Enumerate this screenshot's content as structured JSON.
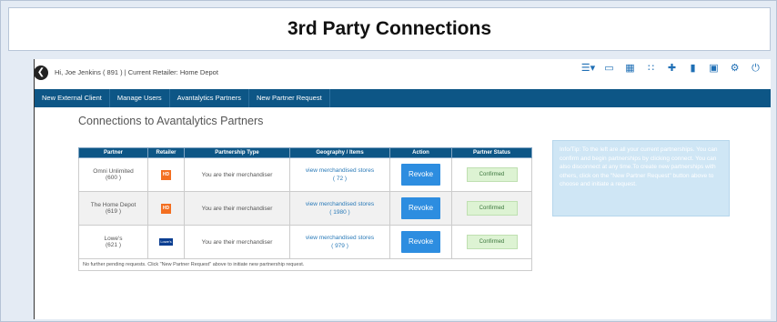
{
  "window": {
    "title": "3rd Party Connections"
  },
  "topbar": {
    "greeting": "Hi, Joe Jenkins ( 891 )   |   Current Retailer: Home Depot",
    "icons": [
      "list-icon",
      "desktop-icon",
      "grid-icon",
      "apps-icon",
      "plus-icon",
      "file-icon",
      "save-icon",
      "settings-icon",
      "power-icon"
    ]
  },
  "nav": {
    "items": [
      "New External Client",
      "Manage Users",
      "Avantalytics Partners",
      "New Partner Request"
    ]
  },
  "main": {
    "title": "Connections to Avantalytics Partners",
    "table": {
      "headers": [
        "Partner",
        "Retailer",
        "Partnership Type",
        "Geography / Items",
        "Action",
        "Partner Status"
      ],
      "rows": [
        {
          "partner": "Omni Unlimited",
          "partner_id": "(600 )",
          "retailer": "home-depot",
          "type": "You are their merchandiser",
          "geo_label": "view merchandised stores",
          "geo_count": "( 72 )",
          "action": "Revoke",
          "status": "Confirmed"
        },
        {
          "partner": "The Home Depot",
          "partner_id": "(619 )",
          "retailer": "home-depot",
          "type": "You are their merchandiser",
          "geo_label": "view merchandised stores",
          "geo_count": "( 1980 )",
          "action": "Revoke",
          "status": "Confirmed"
        },
        {
          "partner": "Lowe's",
          "partner_id": "(621 )",
          "retailer": "lowes",
          "type": "You are their merchandiser",
          "geo_label": "view merchandised stores",
          "geo_count": "( 979 )",
          "action": "Revoke",
          "status": "Confirmed"
        }
      ],
      "footer": "No further pending requests. Click \"New Partner Request\" above to initiate new partnership request."
    },
    "info_tip": "Info/Tip: To the left are all your current partnerships. You can confirm and begin partnerships by clicking connect. You can also disconnect at any time.To create new partnerships with others, click on the \"New Partner Request\" button above to choose and initiate a request."
  },
  "logos": {
    "home_depot": "HD",
    "lowes": "Lowe's"
  }
}
